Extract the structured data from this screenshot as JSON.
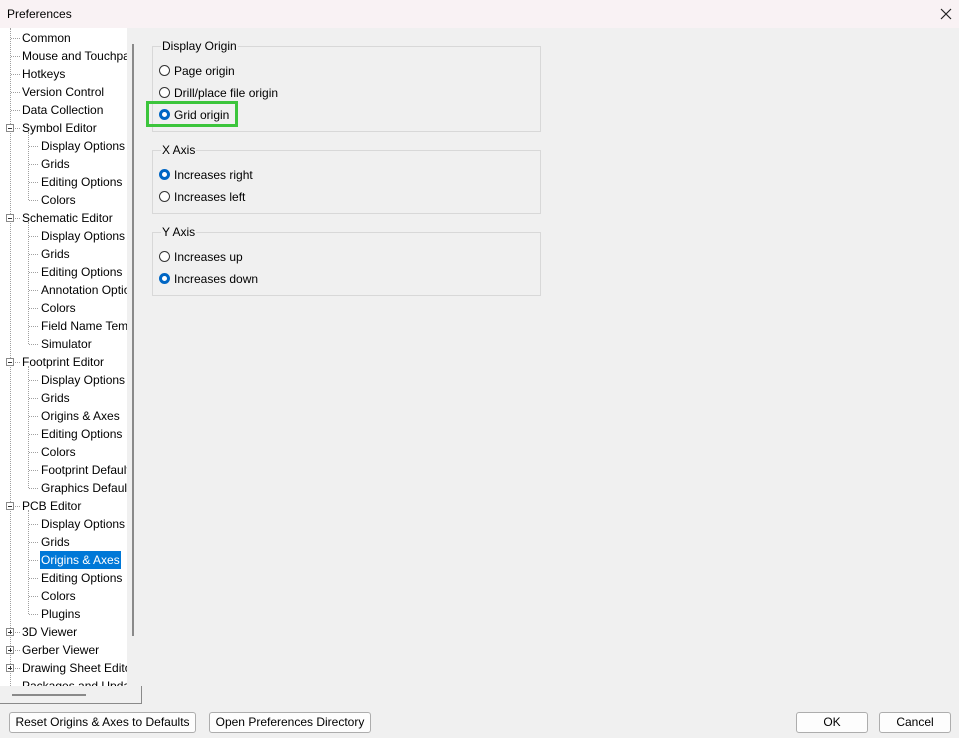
{
  "window": {
    "title": "Preferences"
  },
  "tree": {
    "items": [
      {
        "label": "Common"
      },
      {
        "label": "Mouse and Touchpad"
      },
      {
        "label": "Hotkeys"
      },
      {
        "label": "Version Control"
      },
      {
        "label": "Data Collection"
      },
      {
        "label": "Symbol Editor"
      },
      {
        "label": "Display Options"
      },
      {
        "label": "Grids"
      },
      {
        "label": "Editing Options"
      },
      {
        "label": "Colors"
      },
      {
        "label": "Schematic Editor"
      },
      {
        "label": "Display Options"
      },
      {
        "label": "Grids"
      },
      {
        "label": "Editing Options"
      },
      {
        "label": "Annotation Options"
      },
      {
        "label": "Colors"
      },
      {
        "label": "Field Name Templates"
      },
      {
        "label": "Simulator"
      },
      {
        "label": "Footprint Editor"
      },
      {
        "label": "Display Options"
      },
      {
        "label": "Grids"
      },
      {
        "label": "Origins & Axes"
      },
      {
        "label": "Editing Options"
      },
      {
        "label": "Colors"
      },
      {
        "label": "Footprint Defaults"
      },
      {
        "label": "Graphics Defaults"
      },
      {
        "label": "PCB Editor"
      },
      {
        "label": "Display Options"
      },
      {
        "label": "Grids"
      },
      {
        "label": "Origins & Axes",
        "selected": true
      },
      {
        "label": "Editing Options"
      },
      {
        "label": "Colors"
      },
      {
        "label": "Plugins"
      },
      {
        "label": "3D Viewer"
      },
      {
        "label": "Gerber Viewer"
      },
      {
        "label": "Drawing Sheet Editor"
      },
      {
        "label": "Packages and Updates"
      }
    ]
  },
  "display_origin": {
    "title": "Display Origin",
    "options": [
      "Page origin",
      "Drill/place file origin",
      "Grid origin"
    ],
    "selected": "Grid origin"
  },
  "x_axis": {
    "title": "X Axis",
    "options": [
      "Increases right",
      "Increases left"
    ],
    "selected": "Increases right"
  },
  "y_axis": {
    "title": "Y Axis",
    "options": [
      "Increases up",
      "Increases down"
    ],
    "selected": "Increases down"
  },
  "buttons": {
    "reset": "Reset Origins & Axes to Defaults",
    "open_dir": "Open Preferences Directory",
    "ok": "OK",
    "cancel": "Cancel"
  },
  "colors": {
    "selection": "#0078d7",
    "radio_checked": "#0066c4",
    "highlight": "#3cc53c"
  }
}
